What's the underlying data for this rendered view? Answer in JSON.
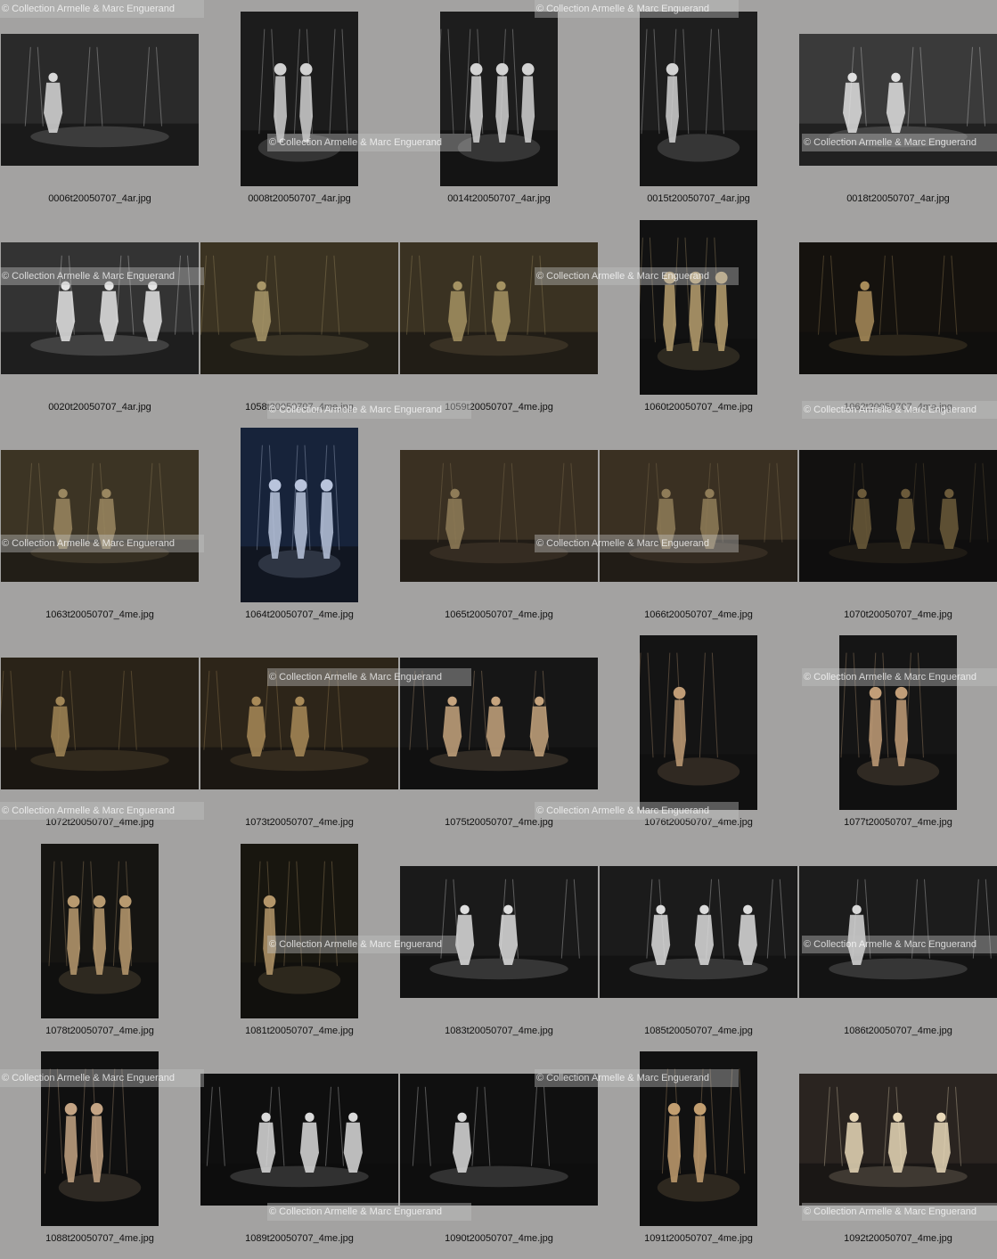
{
  "watermark": "© Collection Armelle & Marc Enguerand",
  "thumbnails": [
    {
      "file": "0006t20050707_4ar.jpg",
      "orient": "land",
      "bg": "#2a2a2a",
      "fg": "#d8d8d8"
    },
    {
      "file": "0008t20050707_4ar.jpg",
      "orient": "port",
      "bg": "#1c1c1c",
      "fg": "#d0d0d0"
    },
    {
      "file": "0014t20050707_4ar.jpg",
      "orient": "port",
      "bg": "#1d1d1d",
      "fg": "#d2d2d2"
    },
    {
      "file": "0015t20050707_4ar.jpg",
      "orient": "port",
      "bg": "#1e1e1e",
      "fg": "#d2d2d2"
    },
    {
      "file": "0018t20050707_4ar.jpg",
      "orient": "land",
      "bg": "#3a3a3a",
      "fg": "#e0e0e0"
    },
    {
      "file": "0020t20050707_4ar.jpg",
      "orient": "land",
      "bg": "#333333",
      "fg": "#e4e4e4"
    },
    {
      "file": "1058t20050707_4me.jpg",
      "orient": "land",
      "bg": "#3b3322",
      "fg": "#a89668"
    },
    {
      "file": "1059t20050707_4me.jpg",
      "orient": "land",
      "bg": "#3a3222",
      "fg": "#a49262"
    },
    {
      "file": "1060t20050707_4me.jpg",
      "orient": "port",
      "bg": "#121212",
      "fg": "#b8a070"
    },
    {
      "file": "1062t20050707_4me.jpg",
      "orient": "land",
      "bg": "#15120e",
      "fg": "#a88c5a"
    },
    {
      "file": "1063t20050707_4me.jpg",
      "orient": "land",
      "bg": "#3c3424",
      "fg": "#9a8760"
    },
    {
      "file": "1064t20050707_4me.jpg",
      "orient": "port",
      "bg": "#17233a",
      "fg": "#b9c4dc"
    },
    {
      "file": "1065t20050707_4me.jpg",
      "orient": "land",
      "bg": "#3a3022",
      "fg": "#8f7c58"
    },
    {
      "file": "1066t20050707_4me.jpg",
      "orient": "land",
      "bg": "#3a3022",
      "fg": "#8f7c58"
    },
    {
      "file": "1070t20050707_4me.jpg",
      "orient": "land",
      "bg": "#121110",
      "fg": "#6b5a3a"
    },
    {
      "file": "1072t20050707_4me.jpg",
      "orient": "land",
      "bg": "#2a2318",
      "fg": "#a08556"
    },
    {
      "file": "1073t20050707_4me.jpg",
      "orient": "land",
      "bg": "#2d2519",
      "fg": "#a88a58"
    },
    {
      "file": "1075t20050707_4me.jpg",
      "orient": "land",
      "bg": "#161616",
      "fg": "#c6a47e"
    },
    {
      "file": "1076t20050707_4me.jpg",
      "orient": "port",
      "bg": "#141414",
      "fg": "#c09c76"
    },
    {
      "file": "1077t20050707_4me.jpg",
      "orient": "port",
      "bg": "#151515",
      "fg": "#c29e78"
    },
    {
      "file": "1078t20050707_4me.jpg",
      "orient": "port",
      "bg": "#161512",
      "fg": "#b89a70"
    },
    {
      "file": "1081t20050707_4me.jpg",
      "orient": "port",
      "bg": "#18160f",
      "fg": "#b4966a"
    },
    {
      "file": "1083t20050707_4me.jpg",
      "orient": "land",
      "bg": "#1a1a1a",
      "fg": "#dedede"
    },
    {
      "file": "1085t20050707_4me.jpg",
      "orient": "land",
      "bg": "#1b1b1b",
      "fg": "#dcdcdc"
    },
    {
      "file": "1086t20050707_4me.jpg",
      "orient": "land",
      "bg": "#1c1c1c",
      "fg": "#d8d8d8"
    },
    {
      "file": "1088t20050707_4me.jpg",
      "orient": "port",
      "bg": "#101010",
      "fg": "#c4a484"
    },
    {
      "file": "1089t20050707_4me.jpg",
      "orient": "land",
      "bg": "#0f0f0f",
      "fg": "#dadada"
    },
    {
      "file": "1090t20050707_4me.jpg",
      "orient": "land",
      "bg": "#101010",
      "fg": "#dadada"
    },
    {
      "file": "1091t20050707_4me.jpg",
      "orient": "port",
      "bg": "#111111",
      "fg": "#c29e70"
    },
    {
      "file": "1092t20050707_4me.jpg",
      "orient": "land",
      "bg": "#2a2420",
      "fg": "#e8d8b8"
    }
  ]
}
